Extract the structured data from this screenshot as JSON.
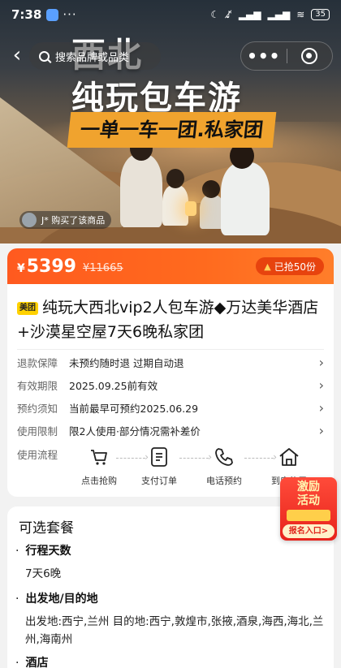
{
  "status_bar": {
    "time": "7:38",
    "more": "···",
    "battery": "35"
  },
  "nav": {
    "search_placeholder": "搜索品牌或品类",
    "more": "•••"
  },
  "hero": {
    "title_line1": "西北",
    "title_line2": "纯玩包车游",
    "banner": "一单一车一团.私家团",
    "buyer_text": "J* 购买了该商品"
  },
  "price": {
    "currency": "¥",
    "current": "5399",
    "original": "¥11665",
    "sold": "已抢50份"
  },
  "product": {
    "tag": "美团",
    "title": "纯玩大西北vip2人包车游◆万达美华酒店+沙漠星空屋7天6晚私家团",
    "rows": [
      {
        "label": "退款保障",
        "value": "未预约随时退 过期自动退"
      },
      {
        "label": "有效期限",
        "value": "2025.09.25前有效"
      },
      {
        "label": "预约须知",
        "value": "当前最早可预约2025.06.29"
      },
      {
        "label": "使用限制",
        "value": "限2人使用·部分情况需补差价"
      }
    ],
    "flow_label": "使用流程",
    "steps": [
      "点击抢购",
      "支付订单",
      "电话预约",
      "到店使用"
    ]
  },
  "promo": {
    "line1": "激励",
    "line2": "活动",
    "entry": "报名入口>"
  },
  "packages": {
    "heading": "可选套餐",
    "items": [
      {
        "label": "行程天数",
        "value": "7天6晚"
      },
      {
        "label": "出发地/目的地",
        "value": "出发地:西宁,兰州 目的地:西宁,敦煌市,张掖,酒泉,海西,海北,兰州,海南州"
      },
      {
        "label": "酒店",
        "value": ""
      }
    ]
  },
  "colors": {
    "accent": "#ff5a1f",
    "banner": "#f0a32e",
    "tag": "#ffd100"
  }
}
